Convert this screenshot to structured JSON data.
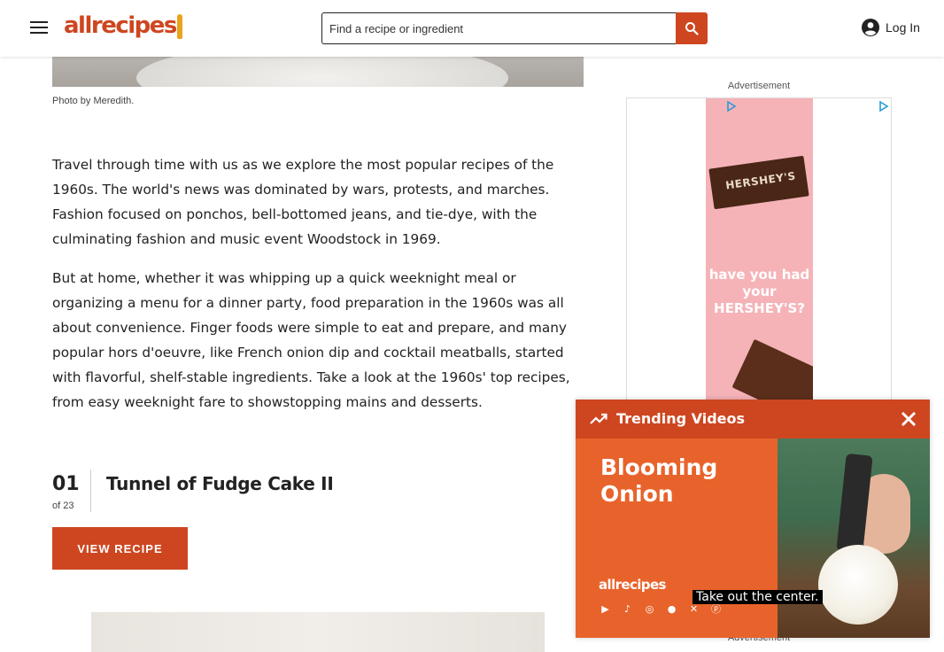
{
  "header": {
    "search_placeholder": "Find a recipe or ingredient",
    "login_label": "Log In",
    "logo_text": "allrecipes",
    "brand_color": "#ce4620"
  },
  "article": {
    "photo_caption": "Photo by Meredith.",
    "paragraphs": [
      "Travel through time with us as we explore the most popular recipes of the 1960s. The world's news was dominated by wars, protests, and marches. Fashion focused on ponchos, bell-bottomed jeans, and tie-dye, with the culminating fashion and music event Woodstock in 1969.",
      "But at home, whether it was whipping up a quick weeknight meal or organizing a menu for a dinner party, food preparation in the 1960s was all about convenience. Finger foods were simple to eat and prepare, and many popular hors d'oeuvre, like French onion dip and cocktail meatballs, started with flavorful, shelf-stable ingredients. Take a look at the 1960s' top recipes, from easy weeknight fare to showstopping mains and desserts."
    ]
  },
  "list_item": {
    "number": "01",
    "of_total": "of 23",
    "title": "Tunnel of Fudge Cake II",
    "button_label": "VIEW RECIPE"
  },
  "sidebar_ad": {
    "label": "Advertisement",
    "brand": "HERSHEY'S",
    "copy": "have you had your HERSHEY'S?"
  },
  "trending": {
    "title": "Trending Videos",
    "video_title": "Blooming Onion",
    "video_logo": "allrecipes",
    "video_subtitle": "Take out the center.",
    "social_icons": [
      "youtube-icon",
      "tiktok-icon",
      "instagram-icon",
      "facebook-icon",
      "x-icon",
      "pinterest-icon"
    ]
  },
  "bottom_ad": {
    "label": "Advertisement"
  }
}
